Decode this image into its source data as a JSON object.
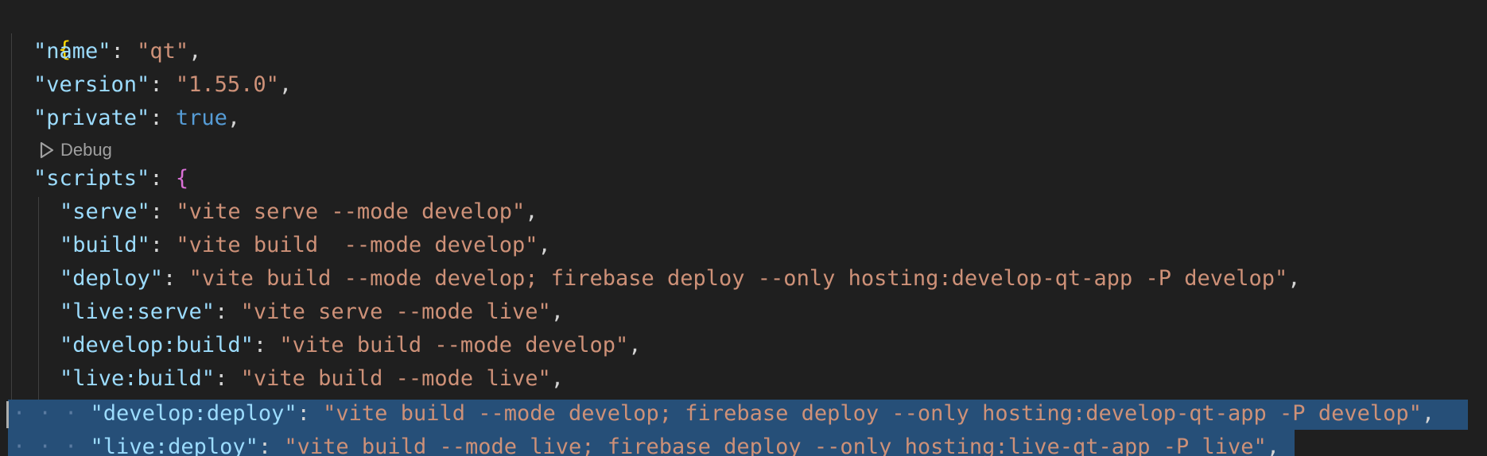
{
  "editor": {
    "codelens_label": "Debug",
    "lines": [
      {
        "open_brace": "{"
      },
      {
        "key": "\"name\"",
        "sep": ": ",
        "value": "\"qt\"",
        "end": ","
      },
      {
        "key": "\"version\"",
        "sep": ": ",
        "value": "\"1.55.0\"",
        "end": ","
      },
      {
        "key": "\"private\"",
        "sep": ": ",
        "value": "true",
        "end": ","
      },
      {
        "key": "\"scripts\"",
        "sep": ": ",
        "value": "{",
        "end": ""
      },
      {
        "key": "\"serve\"",
        "sep": ": ",
        "value": "\"vite serve --mode develop\"",
        "end": ","
      },
      {
        "key": "\"build\"",
        "sep": ": ",
        "value": "\"vite build  --mode develop\"",
        "end": ","
      },
      {
        "key": "\"deploy\"",
        "sep": ": ",
        "value": "\"vite build --mode develop; firebase deploy --only hosting:develop-qt-app -P develop\"",
        "end": ","
      },
      {
        "key": "\"live:serve\"",
        "sep": ": ",
        "value": "\"vite serve --mode live\"",
        "end": ","
      },
      {
        "key": "\"develop:build\"",
        "sep": ": ",
        "value": "\"vite build --mode develop\"",
        "end": ","
      },
      {
        "key": "\"live:build\"",
        "sep": ": ",
        "value": "\"vite build --mode live\"",
        "end": ","
      },
      {
        "key": "\"develop:deploy\"",
        "sep": ": ",
        "value": "\"vite build --mode develop; firebase deploy --only hosting:develop-qt-app -P develop\"",
        "end": ","
      },
      {
        "key": "\"live:deploy\"",
        "sep": ": ",
        "value": "\"vite build --mode live; firebase deploy --only hosting:live-qt-app -P live\"",
        "end": ","
      }
    ],
    "selection_whitespace": "· · ·"
  },
  "colors": {
    "background": "#1f1f1f",
    "key": "#9cdcfe",
    "string": "#ce9178",
    "boolean": "#569cd6",
    "brace_gold": "#ffd700",
    "brace_purple": "#da70d6",
    "selection": "#264f78"
  }
}
